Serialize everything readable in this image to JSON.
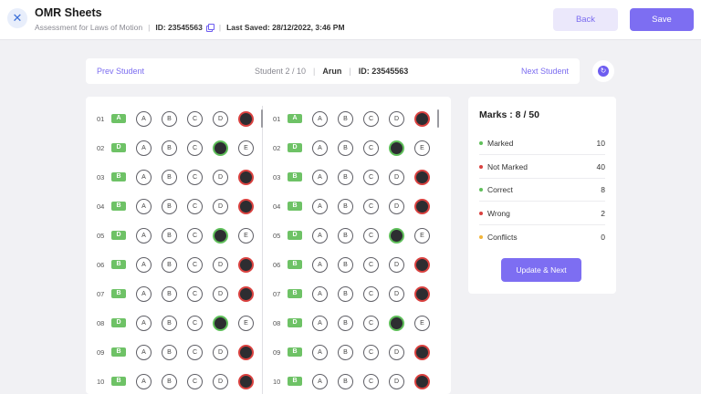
{
  "header": {
    "close_icon": "close-icon",
    "title": "OMR Sheets",
    "subtitle": "Assessment for Laws of Motion",
    "id_text": "ID: 23545563",
    "copy_icon": "copy-icon",
    "last_saved": "Last Saved: 28/12/2022, 3:46 PM",
    "back_label": "Back",
    "save_label": "Save"
  },
  "student_bar": {
    "prev_label": "Prev Student",
    "position": "Student 2 / 10",
    "name": "Arun",
    "id_text": "ID: 23545563",
    "next_label": "Next Student",
    "scan_icon": "scan-icon"
  },
  "colors": {
    "accent": "#7d6ef2",
    "correct": "#5fbf5a",
    "wrong": "#d9413f",
    "conflict": "#f2b53a"
  },
  "sheet": {
    "options": [
      "A",
      "B",
      "C",
      "D",
      "E"
    ],
    "columns": [
      {
        "questions": [
          {
            "num": "01",
            "answer": "A",
            "marked": "E"
          },
          {
            "num": "02",
            "answer": "D",
            "marked": "D"
          },
          {
            "num": "03",
            "answer": "B",
            "marked": "E"
          },
          {
            "num": "04",
            "answer": "B",
            "marked": "E"
          },
          {
            "num": "05",
            "answer": "D",
            "marked": "D"
          },
          {
            "num": "06",
            "answer": "B",
            "marked": "E"
          },
          {
            "num": "07",
            "answer": "B",
            "marked": "E"
          },
          {
            "num": "08",
            "answer": "D",
            "marked": "D"
          },
          {
            "num": "09",
            "answer": "B",
            "marked": "E"
          },
          {
            "num": "10",
            "answer": "B",
            "marked": "E"
          }
        ]
      },
      {
        "questions": [
          {
            "num": "01",
            "answer": "A",
            "marked": "E"
          },
          {
            "num": "02",
            "answer": "D",
            "marked": "D"
          },
          {
            "num": "03",
            "answer": "B",
            "marked": "E"
          },
          {
            "num": "04",
            "answer": "B",
            "marked": "E"
          },
          {
            "num": "05",
            "answer": "D",
            "marked": "D"
          },
          {
            "num": "06",
            "answer": "B",
            "marked": "E"
          },
          {
            "num": "07",
            "answer": "B",
            "marked": "E"
          },
          {
            "num": "08",
            "answer": "D",
            "marked": "D"
          },
          {
            "num": "09",
            "answer": "B",
            "marked": "E"
          },
          {
            "num": "10",
            "answer": "B",
            "marked": "E"
          }
        ]
      }
    ]
  },
  "marks": {
    "title": "Marks : 8 / 50",
    "stats": [
      {
        "label": "Marked",
        "value": "10",
        "color": "#5fbf5a"
      },
      {
        "label": "Not Marked",
        "value": "40",
        "color": "#d9413f"
      },
      {
        "label": "Correct",
        "value": "8",
        "color": "#5fbf5a"
      },
      {
        "label": "Wrong",
        "value": "2",
        "color": "#d9413f"
      },
      {
        "label": "Conflicts",
        "value": "0",
        "color": "#f2b53a"
      }
    ],
    "update_label": "Update & Next"
  }
}
